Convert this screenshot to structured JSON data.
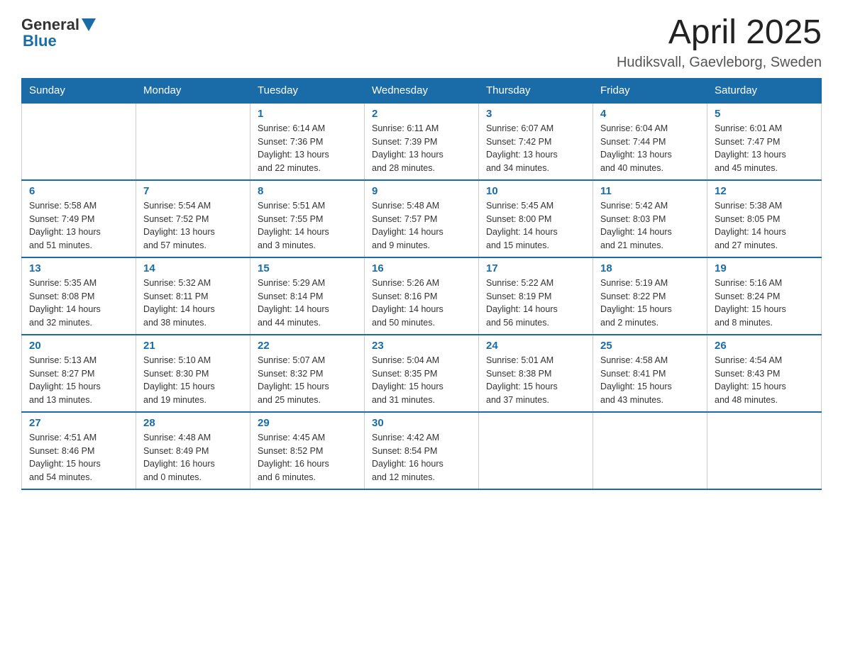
{
  "header": {
    "logo": {
      "text_general": "General",
      "text_blue": "Blue"
    },
    "title": "April 2025",
    "subtitle": "Hudiksvall, Gaevleborg, Sweden"
  },
  "days_of_week": [
    "Sunday",
    "Monday",
    "Tuesday",
    "Wednesday",
    "Thursday",
    "Friday",
    "Saturday"
  ],
  "weeks": [
    [
      {
        "day": "",
        "info": ""
      },
      {
        "day": "",
        "info": ""
      },
      {
        "day": "1",
        "info": "Sunrise: 6:14 AM\nSunset: 7:36 PM\nDaylight: 13 hours\nand 22 minutes."
      },
      {
        "day": "2",
        "info": "Sunrise: 6:11 AM\nSunset: 7:39 PM\nDaylight: 13 hours\nand 28 minutes."
      },
      {
        "day": "3",
        "info": "Sunrise: 6:07 AM\nSunset: 7:42 PM\nDaylight: 13 hours\nand 34 minutes."
      },
      {
        "day": "4",
        "info": "Sunrise: 6:04 AM\nSunset: 7:44 PM\nDaylight: 13 hours\nand 40 minutes."
      },
      {
        "day": "5",
        "info": "Sunrise: 6:01 AM\nSunset: 7:47 PM\nDaylight: 13 hours\nand 45 minutes."
      }
    ],
    [
      {
        "day": "6",
        "info": "Sunrise: 5:58 AM\nSunset: 7:49 PM\nDaylight: 13 hours\nand 51 minutes."
      },
      {
        "day": "7",
        "info": "Sunrise: 5:54 AM\nSunset: 7:52 PM\nDaylight: 13 hours\nand 57 minutes."
      },
      {
        "day": "8",
        "info": "Sunrise: 5:51 AM\nSunset: 7:55 PM\nDaylight: 14 hours\nand 3 minutes."
      },
      {
        "day": "9",
        "info": "Sunrise: 5:48 AM\nSunset: 7:57 PM\nDaylight: 14 hours\nand 9 minutes."
      },
      {
        "day": "10",
        "info": "Sunrise: 5:45 AM\nSunset: 8:00 PM\nDaylight: 14 hours\nand 15 minutes."
      },
      {
        "day": "11",
        "info": "Sunrise: 5:42 AM\nSunset: 8:03 PM\nDaylight: 14 hours\nand 21 minutes."
      },
      {
        "day": "12",
        "info": "Sunrise: 5:38 AM\nSunset: 8:05 PM\nDaylight: 14 hours\nand 27 minutes."
      }
    ],
    [
      {
        "day": "13",
        "info": "Sunrise: 5:35 AM\nSunset: 8:08 PM\nDaylight: 14 hours\nand 32 minutes."
      },
      {
        "day": "14",
        "info": "Sunrise: 5:32 AM\nSunset: 8:11 PM\nDaylight: 14 hours\nand 38 minutes."
      },
      {
        "day": "15",
        "info": "Sunrise: 5:29 AM\nSunset: 8:14 PM\nDaylight: 14 hours\nand 44 minutes."
      },
      {
        "day": "16",
        "info": "Sunrise: 5:26 AM\nSunset: 8:16 PM\nDaylight: 14 hours\nand 50 minutes."
      },
      {
        "day": "17",
        "info": "Sunrise: 5:22 AM\nSunset: 8:19 PM\nDaylight: 14 hours\nand 56 minutes."
      },
      {
        "day": "18",
        "info": "Sunrise: 5:19 AM\nSunset: 8:22 PM\nDaylight: 15 hours\nand 2 minutes."
      },
      {
        "day": "19",
        "info": "Sunrise: 5:16 AM\nSunset: 8:24 PM\nDaylight: 15 hours\nand 8 minutes."
      }
    ],
    [
      {
        "day": "20",
        "info": "Sunrise: 5:13 AM\nSunset: 8:27 PM\nDaylight: 15 hours\nand 13 minutes."
      },
      {
        "day": "21",
        "info": "Sunrise: 5:10 AM\nSunset: 8:30 PM\nDaylight: 15 hours\nand 19 minutes."
      },
      {
        "day": "22",
        "info": "Sunrise: 5:07 AM\nSunset: 8:32 PM\nDaylight: 15 hours\nand 25 minutes."
      },
      {
        "day": "23",
        "info": "Sunrise: 5:04 AM\nSunset: 8:35 PM\nDaylight: 15 hours\nand 31 minutes."
      },
      {
        "day": "24",
        "info": "Sunrise: 5:01 AM\nSunset: 8:38 PM\nDaylight: 15 hours\nand 37 minutes."
      },
      {
        "day": "25",
        "info": "Sunrise: 4:58 AM\nSunset: 8:41 PM\nDaylight: 15 hours\nand 43 minutes."
      },
      {
        "day": "26",
        "info": "Sunrise: 4:54 AM\nSunset: 8:43 PM\nDaylight: 15 hours\nand 48 minutes."
      }
    ],
    [
      {
        "day": "27",
        "info": "Sunrise: 4:51 AM\nSunset: 8:46 PM\nDaylight: 15 hours\nand 54 minutes."
      },
      {
        "day": "28",
        "info": "Sunrise: 4:48 AM\nSunset: 8:49 PM\nDaylight: 16 hours\nand 0 minutes."
      },
      {
        "day": "29",
        "info": "Sunrise: 4:45 AM\nSunset: 8:52 PM\nDaylight: 16 hours\nand 6 minutes."
      },
      {
        "day": "30",
        "info": "Sunrise: 4:42 AM\nSunset: 8:54 PM\nDaylight: 16 hours\nand 12 minutes."
      },
      {
        "day": "",
        "info": ""
      },
      {
        "day": "",
        "info": ""
      },
      {
        "day": "",
        "info": ""
      }
    ]
  ]
}
